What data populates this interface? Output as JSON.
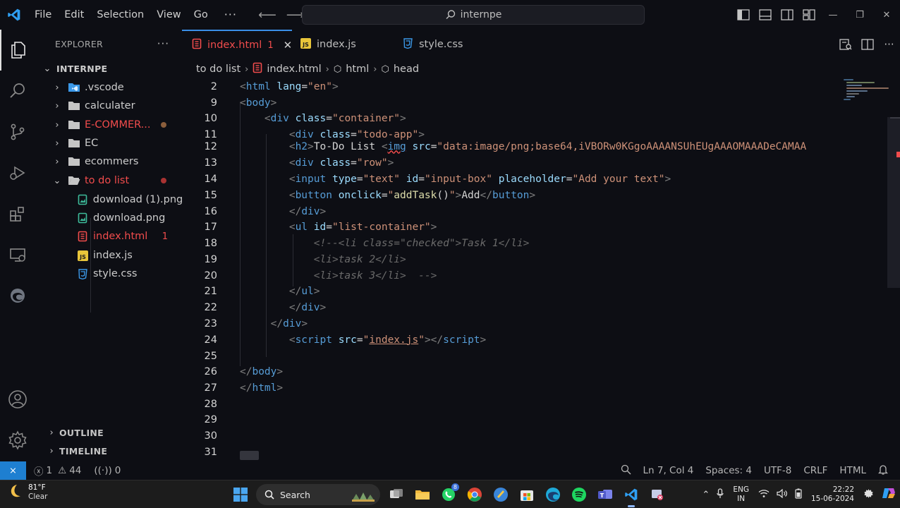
{
  "window": {
    "search_text": "internpe"
  },
  "menu": [
    "File",
    "Edit",
    "Selection",
    "View",
    "Go",
    "···"
  ],
  "explorer": {
    "title": "EXPLORER",
    "root": "INTERNPE",
    "items": [
      {
        "label": ".vscode",
        "kind": "folder-vscode",
        "indent": 0,
        "chevron": "›"
      },
      {
        "label": "calculater",
        "kind": "folder",
        "indent": 0,
        "chevron": "›"
      },
      {
        "label": "E-COMMER...",
        "kind": "folder",
        "indent": 0,
        "chevron": "›",
        "dot_color": "#8b5e3c"
      },
      {
        "label": "EC",
        "kind": "folder",
        "indent": 0,
        "chevron": "›"
      },
      {
        "label": "ecommers",
        "kind": "folder",
        "indent": 0,
        "chevron": "›"
      },
      {
        "label": "to do list",
        "kind": "folder-open",
        "indent": 0,
        "chevron": "⌄",
        "dot_color": "#a83232"
      },
      {
        "label": "download (1).png",
        "kind": "image",
        "indent": 1
      },
      {
        "label": "download.png",
        "kind": "image",
        "indent": 1
      },
      {
        "label": "index.html",
        "kind": "html",
        "indent": 1,
        "badge": "1"
      },
      {
        "label": "index.js",
        "kind": "js",
        "indent": 1
      },
      {
        "label": "style.css",
        "kind": "css",
        "indent": 1
      }
    ],
    "sections": [
      "OUTLINE",
      "TIMELINE"
    ]
  },
  "tabs": [
    {
      "label": "index.html",
      "badge": "1",
      "kind": "html",
      "active": true
    },
    {
      "label": "index.js",
      "kind": "js"
    },
    {
      "label": "style.css",
      "kind": "css"
    }
  ],
  "breadcrumb": [
    "to do list",
    "index.html",
    "html",
    "head"
  ],
  "code_lines": [
    "2",
    "9",
    "10",
    "11",
    "12",
    "13",
    "14",
    "15",
    "16",
    "17",
    "18",
    "19",
    "20",
    "21",
    "22",
    "23",
    "24",
    "25",
    "26",
    "27",
    "28",
    "29",
    "30",
    "31"
  ],
  "status": {
    "errors": "1",
    "warnings": "44",
    "ports": "0",
    "position": "Ln 7, Col 4",
    "spaces": "Spaces: 4",
    "encoding": "UTF-8",
    "eol": "CRLF",
    "language": "HTML"
  },
  "taskbar": {
    "temperature": "81°F",
    "condition": "Clear",
    "search": "Search",
    "lang_top": "ENG",
    "lang_bottom": "IN",
    "time": "22:22",
    "date": "15-06-2024",
    "whatsapp_badge": "8"
  }
}
